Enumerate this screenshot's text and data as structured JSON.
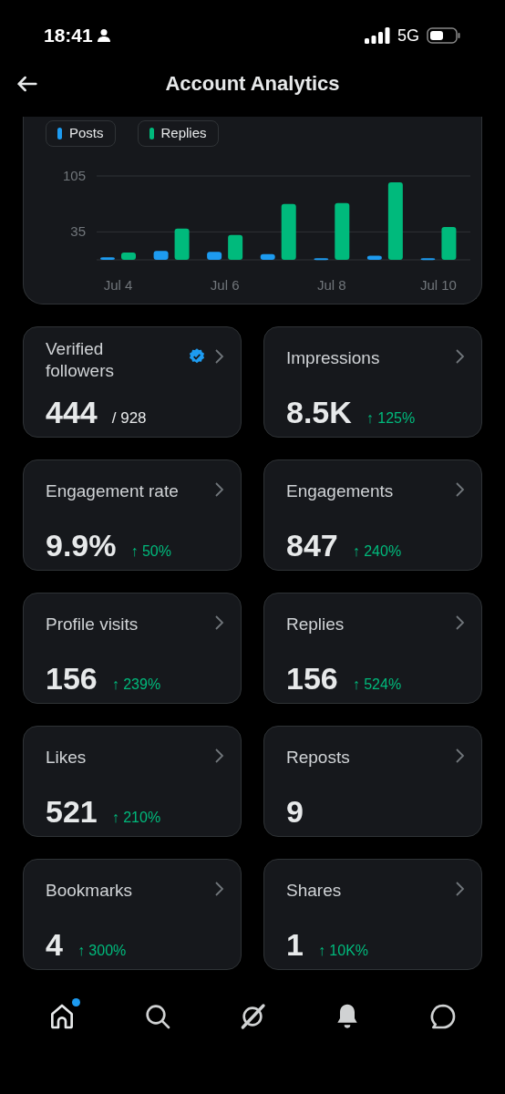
{
  "status_bar": {
    "time": "18:41",
    "network": "5G"
  },
  "header": {
    "title": "Account Analytics"
  },
  "chart": {
    "chart_data": {
      "type": "bar",
      "stacked": false,
      "categories": [
        "Jul 4",
        null,
        "Jul 6",
        null,
        "Jul 8",
        null,
        "Jul 10"
      ],
      "series": [
        {
          "name": "Posts",
          "color": "#1d9bf0",
          "values": [
            3,
            11,
            10,
            7,
            2,
            5,
            2
          ]
        },
        {
          "name": "Replies",
          "color": "#00ba7c",
          "values": [
            9,
            39,
            31,
            70,
            71,
            97,
            41
          ]
        }
      ],
      "ylim": [
        0,
        105
      ],
      "yticks": [
        35,
        105
      ]
    }
  },
  "metrics": [
    {
      "label": "Verified followers",
      "value": "444",
      "total": "/ 928",
      "verified": true
    },
    {
      "label": "Impressions",
      "value": "8.5K",
      "change": "↑ 125%",
      "verified": false
    },
    {
      "label": "Engagement rate",
      "value": "9.9%",
      "change": "↑ 50%",
      "verified": false
    },
    {
      "label": "Engagements",
      "value": "847",
      "change": "↑ 240%",
      "verified": false
    },
    {
      "label": "Profile visits",
      "value": "156",
      "change": "↑ 239%",
      "verified": false
    },
    {
      "label": "Replies",
      "value": "156",
      "change": "↑ 524%",
      "verified": false
    },
    {
      "label": "Likes",
      "value": "521",
      "change": "↑ 210%",
      "verified": false
    },
    {
      "label": "Reposts",
      "value": "9",
      "verified": false
    },
    {
      "label": "Bookmarks",
      "value": "4",
      "change": "↑ 300%",
      "verified": false
    },
    {
      "label": "Shares",
      "value": "1",
      "change": "↑ 10K%",
      "verified": false
    }
  ],
  "bottom_nav": [
    {
      "kind": "home",
      "selected": true,
      "badge": true
    },
    {
      "kind": "search",
      "selected": false,
      "badge": false
    },
    {
      "kind": "grok",
      "selected": false,
      "badge": false
    },
    {
      "kind": "bell",
      "selected": false,
      "badge": false
    },
    {
      "kind": "chat",
      "selected": false,
      "badge": false
    }
  ]
}
